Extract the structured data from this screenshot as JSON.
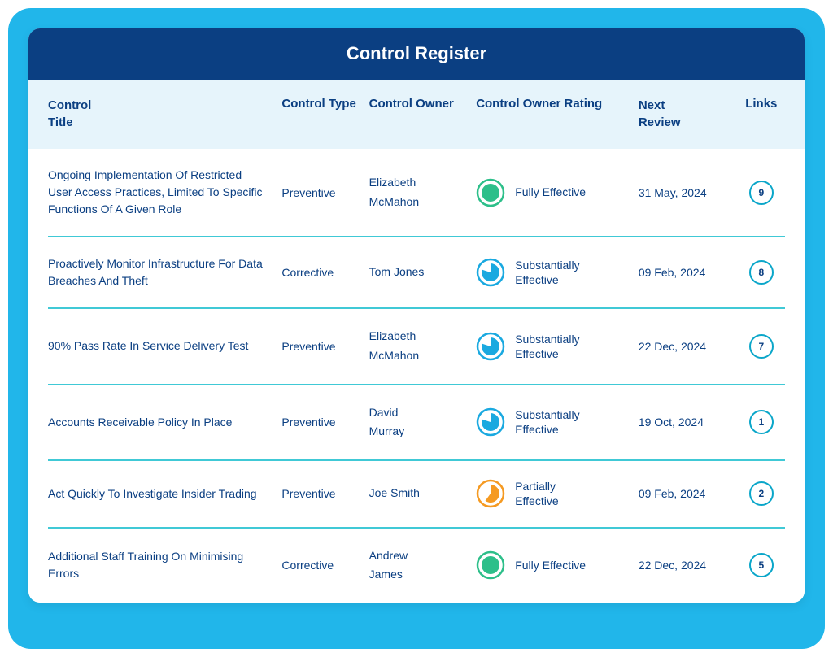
{
  "header": {
    "title": "Control Register"
  },
  "columns": {
    "title_l1": "Control",
    "title_l2": "Title",
    "type": "Control Type",
    "owner": "Control Owner",
    "rating": "Control Owner Rating",
    "review_l1": "Next",
    "review_l2": "Review",
    "links": "Links"
  },
  "ratings": {
    "full": {
      "label": "Fully Effective",
      "color": "#2dbf8a",
      "fill": 1.0
    },
    "sub": {
      "label": "Substantially Effective",
      "color": "#1aa9e0",
      "fill": 0.8
    },
    "part": {
      "label": "Partially Effective",
      "color": "#f59a22",
      "fill": 0.6
    }
  },
  "rows": [
    {
      "title": "Ongoing Implementation Of Restricted User Access Practices, Limited To Specific Functions Of A Given Role",
      "type": "Preventive",
      "owner": "Elizabeth McMahon",
      "rating": "full",
      "review": "31 May, 2024",
      "links": "9"
    },
    {
      "title": "Proactively Monitor Infrastructure For Data Breaches And Theft",
      "type": "Corrective",
      "owner": "Tom Jones",
      "rating": "sub",
      "review": "09 Feb, 2024",
      "links": "8"
    },
    {
      "title": "90% Pass Rate In Service Delivery Test",
      "type": "Preventive",
      "owner": "Elizabeth McMahon",
      "rating": "sub",
      "review": "22 Dec, 2024",
      "links": "7"
    },
    {
      "title": "Accounts Receivable Policy In Place",
      "type": "Preventive",
      "owner": "David Murray",
      "rating": "sub",
      "review": "19 Oct, 2024",
      "links": "1"
    },
    {
      "title": "Act Quickly To Investigate Insider Trading",
      "type": "Preventive",
      "owner": "Joe Smith",
      "rating": "part",
      "review": "09 Feb, 2024",
      "links": "2"
    },
    {
      "title": "Additional Staff Training On Minimising Errors",
      "type": "Corrective",
      "owner": "Andrew James",
      "rating": "full",
      "review": "22 Dec, 2024",
      "links": "5"
    }
  ]
}
